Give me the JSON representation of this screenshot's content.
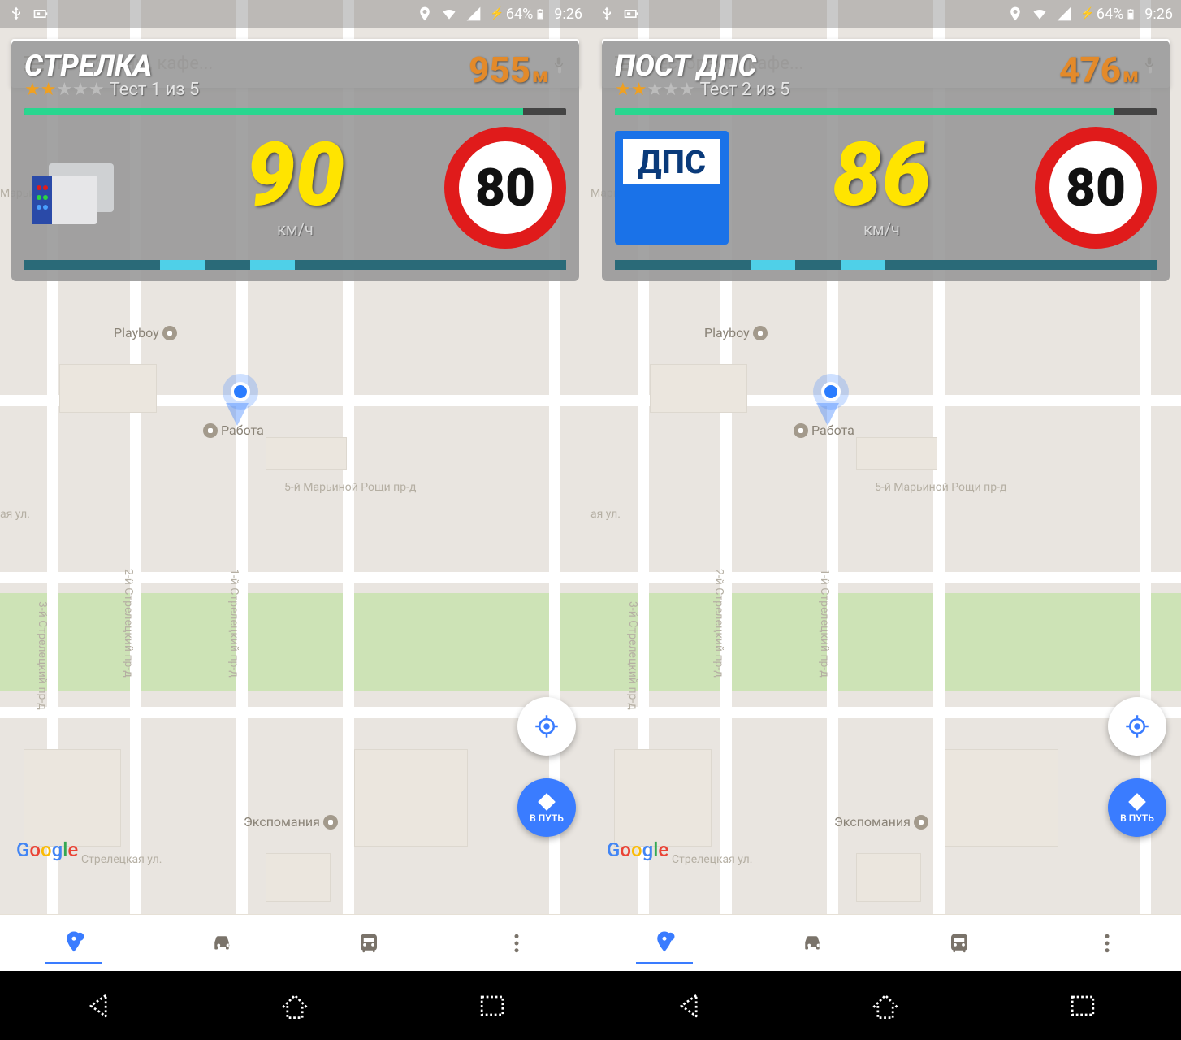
{
  "status": {
    "battery": "64%",
    "time": "9:26"
  },
  "search": {
    "placeholder": "Рестораны, кафе..."
  },
  "map": {
    "poi_playboy": "Playboy",
    "poi_work": "Работа",
    "poi_expo": "Экспомания",
    "street_h1": "5-й Марьиной Рощи пр-д",
    "street_h2": "ая ул.",
    "street_h3": "Стрелецкая ул.",
    "street_v1": "1-й Стрелецкий пр-д",
    "street_v2": "2-й Стрелецкий пр-д",
    "street_v3": "3-й Стрелецкий пр-д",
    "street_side": "Марьиной Рощи",
    "google": "Google"
  },
  "fab": {
    "go_label": "В ПУТЬ"
  },
  "screens": [
    {
      "title": "СТРЕЛКА",
      "distance": "955",
      "distance_unit": "м",
      "rating_text": "Тест 1 из 5",
      "speed": "90",
      "speed_unit": "км/ч",
      "limit": "80",
      "prog1_pct": 92,
      "icon_type": "camera",
      "dps_text": ""
    },
    {
      "title": "ПОСТ ДПС",
      "distance": "476",
      "distance_unit": "м",
      "rating_text": "Тест 2 из 5",
      "speed": "86",
      "speed_unit": "км/ч",
      "limit": "80",
      "prog1_pct": 92,
      "icon_type": "dps",
      "dps_text": "ДПС"
    }
  ]
}
